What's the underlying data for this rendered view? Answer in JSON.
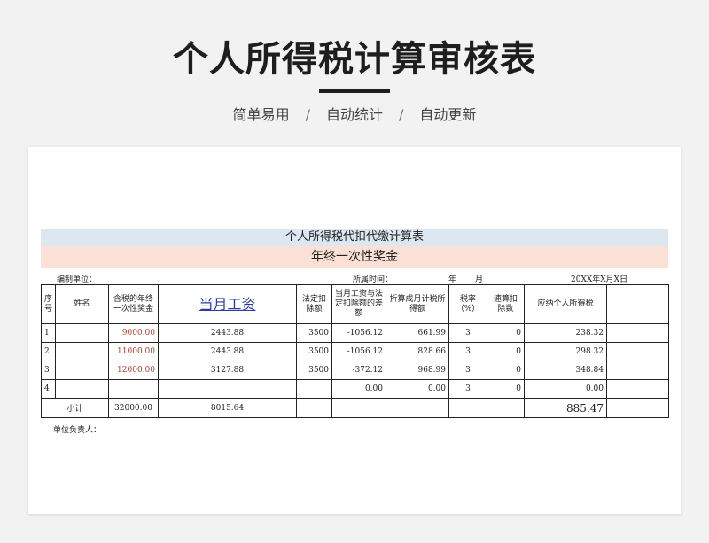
{
  "header": {
    "title": "个人所得税计算审核表",
    "tags": [
      "简单易用",
      "自动统计",
      "自动更新"
    ],
    "separator": "/"
  },
  "sheet": {
    "title": "个人所得税代扣代缴计算表",
    "subtitle": "年终一次性奖金",
    "unit_label": "编制单位：",
    "period_label": "所属时间：",
    "year_label": "年",
    "month_label": "月",
    "date_text": "20XX年X月X日",
    "columns": [
      "序号",
      "姓名",
      "含税的年终一次性奖金",
      "当月工资",
      "法定扣除额",
      "当月工资与法定扣除额的差额",
      "折算成月计税所得额",
      "税率（%）",
      "速算扣除数",
      "应纳个人所得税"
    ],
    "rows": [
      {
        "no": "1",
        "name": "",
        "bonus": "9000.00",
        "wage": "2443.88",
        "deduct": "3500",
        "diff": "-1056.12",
        "monthly": "661.99",
        "rate": "3",
        "quick": "0",
        "tax": "238.32"
      },
      {
        "no": "2",
        "name": "",
        "bonus": "11000.00",
        "wage": "2443.88",
        "deduct": "3500",
        "diff": "-1056.12",
        "monthly": "828.66",
        "rate": "3",
        "quick": "0",
        "tax": "298.32"
      },
      {
        "no": "3",
        "name": "",
        "bonus": "12000.00",
        "wage": "3127.88",
        "deduct": "3500",
        "diff": "-372.12",
        "monthly": "968.99",
        "rate": "3",
        "quick": "0",
        "tax": "348.84"
      },
      {
        "no": "4",
        "name": "",
        "bonus": "",
        "wage": "",
        "deduct": "",
        "diff": "0.00",
        "monthly": "0.00",
        "rate": "3",
        "quick": "0",
        "tax": "0.00"
      }
    ],
    "subtotal": {
      "label": "小计",
      "bonus": "32000.00",
      "wage": "8015.64",
      "tax": "885.47"
    },
    "signer_label": "单位负责人："
  },
  "colors": {
    "band_blue": "#dde7f1",
    "band_pink": "#fbe1d5",
    "bonus_red": "#c0392b",
    "wage_header_blue": "#2b3aa3"
  }
}
